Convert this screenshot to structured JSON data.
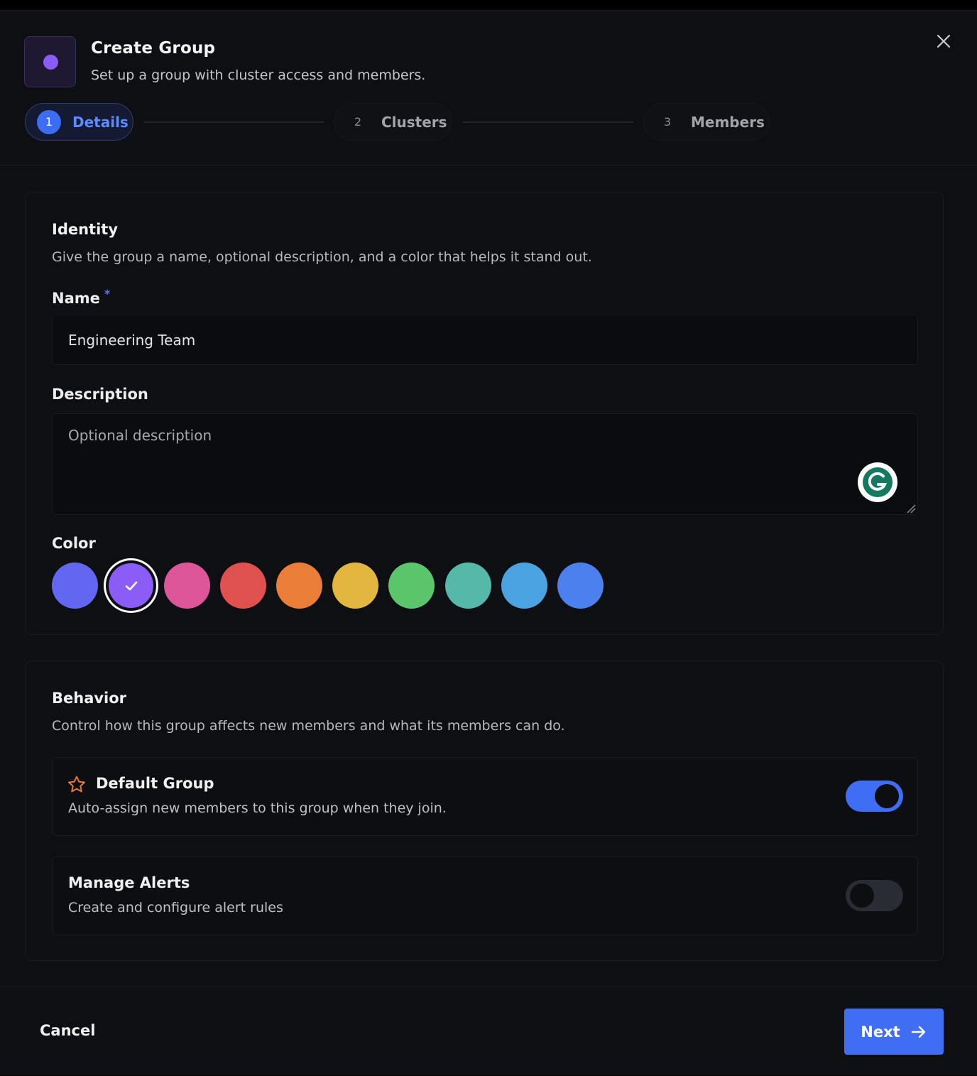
{
  "dialog": {
    "title": "Create Group",
    "subtitle": "Set up a group with cluster access and members.",
    "icon_color": "#8b5cf6"
  },
  "steps": [
    {
      "number": "1",
      "label": "Details",
      "active": true
    },
    {
      "number": "2",
      "label": "Clusters",
      "active": false
    },
    {
      "number": "3",
      "label": "Members",
      "active": false
    }
  ],
  "identity": {
    "title": "Identity",
    "description": "Give the group a name, optional description, and a color that helps it stand out.",
    "name_label": "Name",
    "required_marker": "*",
    "name_value": "Engineering Team",
    "description_label": "Description",
    "description_placeholder": "Optional description",
    "color_label": "Color",
    "colors": [
      "#6366f1",
      "#8b5cf6",
      "#dc5699",
      "#df514f",
      "#ea7d37",
      "#e3b73f",
      "#5ac56b",
      "#55b8a9",
      "#4ba4e1",
      "#4b80ee"
    ],
    "selected_color": "#8b5cf6"
  },
  "behavior": {
    "title": "Behavior",
    "description": "Control how this group affects new members and what its members can do.",
    "options": [
      {
        "title": "Default Group",
        "description": "Auto-assign new members to this group when they join.",
        "icon": "star-icon",
        "enabled": true
      },
      {
        "title": "Manage Alerts",
        "description": "Create and configure alert rules",
        "enabled": false
      }
    ]
  },
  "footer": {
    "cancel_label": "Cancel",
    "next_label": "Next"
  },
  "colors": {
    "accent": "#3f6ef4",
    "star": "#e07b39"
  }
}
